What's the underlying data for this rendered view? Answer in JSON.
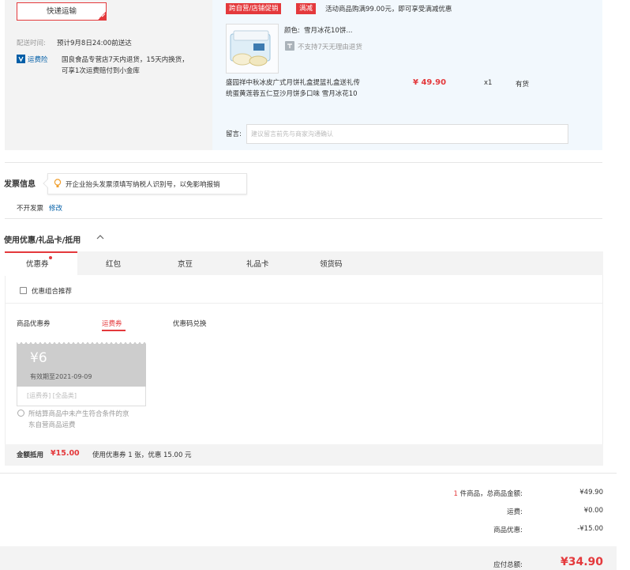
{
  "delivery": {
    "ship_method": "快递运输",
    "time_label": "配送时间:",
    "time_value": "预计9月8日24:00前送达",
    "insurance_label": "运费险",
    "insurance_text_1": "国良食品专营店7天内退货，15天内换货，",
    "insurance_text_2": "可享1次运费赔付到小金库"
  },
  "product": {
    "tag_1": "跨自营/店铺促销",
    "tag_2": "满减",
    "promo_text": "活动商品购满99.00元，即可享受满减优惠",
    "color_label": "颜色:",
    "color_value": "雪月冰花10饼...",
    "return_policy": "不支持7天无理由退货",
    "title_1": "盛园祥中秋冰皮广式月饼礼盒提篮礼盒送礼传",
    "title_2": "统蛋黄莲蓉五仁豆沙月饼多口味 雪月冰花10",
    "price": "¥ 49.90",
    "qty": "x1",
    "stock": "有货",
    "note_label": "留言:",
    "note_placeholder": "建议留言前先与商家沟通确认"
  },
  "invoice": {
    "title": "发票信息",
    "tip": "开企业抬头发票须填写纳税人识别号，以免影响报销",
    "status": "不开发票",
    "modify": "修改"
  },
  "coupons": {
    "title": "使用优惠/礼品卡/抵用",
    "tabs": [
      "优惠券",
      "红包",
      "京豆",
      "礼品卡",
      "领货码"
    ],
    "combo_label": "优惠组合推荐",
    "subtabs": [
      "商品优惠券",
      "运费券",
      "优惠码兑换"
    ],
    "card_amount": "¥6",
    "card_expiry": "有效期至2021-09-09",
    "card_type": "[运费券] [全品类]",
    "card_note_1": "所结算商品中未产生符合条件的京",
    "card_note_2": "东自营商品运费",
    "summary_label": "金额抵用",
    "summary_amount": "¥15.00",
    "summary_text": "使用优惠券 1 张，优惠 15.00 元"
  },
  "totals": {
    "items_count": "1",
    "items_label": "件商品，总商品金额:",
    "items_value": "¥49.90",
    "shipping_label": "运费:",
    "shipping_value": "¥0.00",
    "discount_label": "商品优惠:",
    "discount_value": "-¥15.00",
    "payable_label": "应付总额:",
    "payable_value": "¥34.90"
  },
  "colors": {
    "accent": "#e4393c",
    "link": "#005ea7",
    "panel": "#f3f3f3",
    "product_bg": "#f2f8fd"
  }
}
